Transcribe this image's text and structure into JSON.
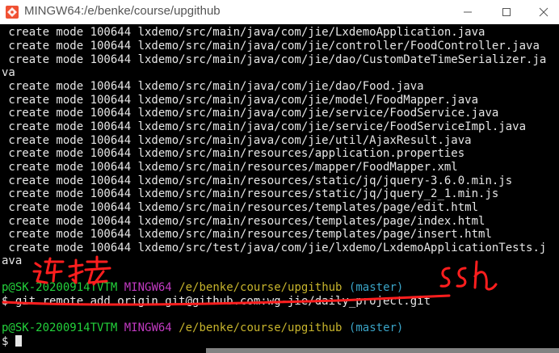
{
  "window": {
    "title": "MINGW64:/e/benke/course/upgithub",
    "app_icon": "git-bash-icon",
    "controls": [
      "minimize",
      "maximize",
      "close"
    ]
  },
  "terminal": {
    "colors": {
      "background": "#000000",
      "text": "#e6e6e6",
      "user": "#23d13b",
      "host": "#c23ac2",
      "path": "#c7b42c",
      "branch": "#3aa4c7",
      "annotation": "#ff1e1e"
    },
    "output_lines": [
      " create mode 100644 lxdemo/src/main/java/com/jie/LxdemoApplication.java",
      " create mode 100644 lxdemo/src/main/java/com/jie/controller/FoodController.java",
      " create mode 100644 lxdemo/src/main/java/com/jie/dao/CustomDateTimeSerializer.ja",
      "va",
      " create mode 100644 lxdemo/src/main/java/com/jie/dao/Food.java",
      " create mode 100644 lxdemo/src/main/java/com/jie/model/FoodMapper.java",
      " create mode 100644 lxdemo/src/main/java/com/jie/service/FoodService.java",
      " create mode 100644 lxdemo/src/main/java/com/jie/service/FoodServiceImpl.java",
      " create mode 100644 lxdemo/src/main/java/com/jie/util/AjaxResult.java",
      " create mode 100644 lxdemo/src/main/resources/application.properties",
      " create mode 100644 lxdemo/src/main/resources/mapper/FoodMapper.xml",
      " create mode 100644 lxdemo/src/main/resources/static/jq/jquery-3.6.0.min.js",
      " create mode 100644 lxdemo/src/main/resources/static/jq/jquery_2_1.min.js",
      " create mode 100644 lxdemo/src/main/resources/templates/page/edit.html",
      " create mode 100644 lxdemo/src/main/resources/templates/page/index.html",
      " create mode 100644 lxdemo/src/main/resources/templates/page/insert.html",
      " create mode 100644 lxdemo/src/test/java/com/jie/lxdemo/LxdemoApplicationTests.j",
      "ava"
    ],
    "prompt1": {
      "user": "p@SK-20200914TVTM",
      "host": "MINGW64",
      "path": "/e/benke/course/upgithub",
      "branch": "(master)"
    },
    "command": "$ git remote add origin git@github.com:wg-jie/daily_project.git",
    "prompt2": {
      "user": "p@SK-20200914TVTM",
      "host": "MINGW64",
      "path": "/e/benke/course/upgithub",
      "branch": "(master)"
    },
    "input_line": "$ "
  },
  "annotations": {
    "handwritten_label_left": "连接",
    "handwritten_label_right": "ssh"
  }
}
